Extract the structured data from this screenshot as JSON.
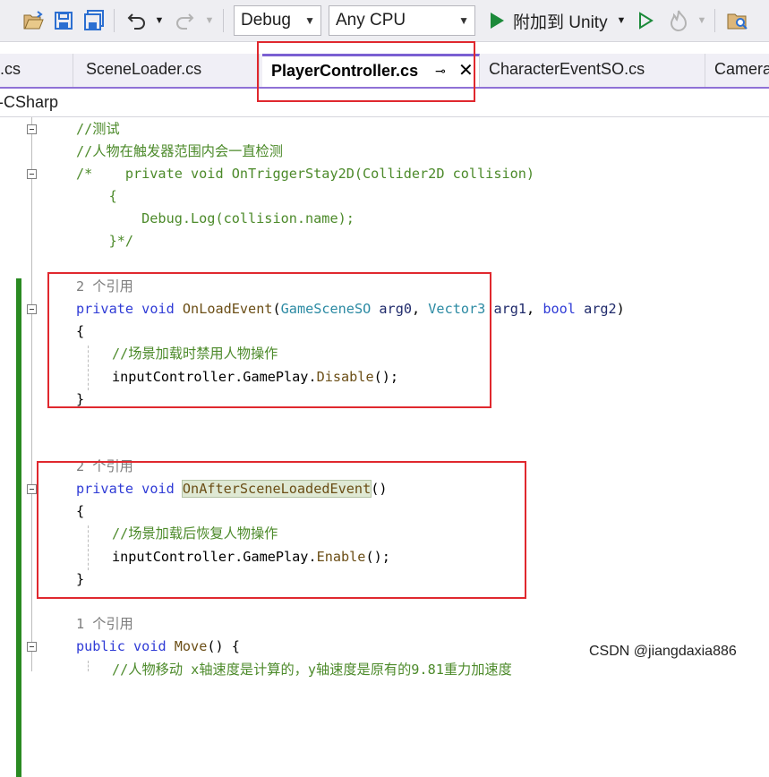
{
  "toolbar": {
    "config": "Debug",
    "platform": "Any CPU",
    "attach_label": "附加到 Unity"
  },
  "tabs": [
    {
      "label": ".cs"
    },
    {
      "label": "SceneLoader.cs"
    },
    {
      "label": "PlayerController.cs"
    },
    {
      "label": "CharacterEventSO.cs"
    },
    {
      "label": "Camera"
    }
  ],
  "navbar": {
    "project": "-CSharp"
  },
  "code": {
    "l1": "//测试",
    "l2": "//人物在触发器范围内会一直检测",
    "l3": "/*    private void OnTriggerStay2D(Collider2D collision)",
    "l4": "    {",
    "l5": "        Debug.Log(collision.name);",
    "l6": "    }*/",
    "ref1": "2 个引用",
    "m1_mod": "private",
    "m1_ret": "void",
    "m1_name": "OnLoadEvent",
    "m1_p1t": "GameSceneSO",
    "m1_p1n": "arg0",
    "m1_p2t": "Vector3",
    "m1_p2n": "arg1",
    "m1_p3t": "bool",
    "m1_p3n": "arg2",
    "brace_open": "{",
    "brace_close": "}",
    "m1_comment": "//场景加载时禁用人物操作",
    "m1_stmt_a": "inputController.GamePlay.",
    "m1_stmt_b": "Disable",
    "m1_stmt_c": "();",
    "ref2": "2 个引用",
    "m2_name": "OnAfterSceneLoadedEvent",
    "m2_comment": "//场景加载后恢复人物操作",
    "m2_stmt_b": "Enable",
    "ref3": "1 个引用",
    "m3_mod": "public",
    "m3_name": "Move",
    "m3_rest": "() {",
    "m3_comment": "//人物移动 x轴速度是计算的，y轴速度是原有的9.81重力加速度"
  },
  "watermark": "CSDN @jiangdaxia886"
}
